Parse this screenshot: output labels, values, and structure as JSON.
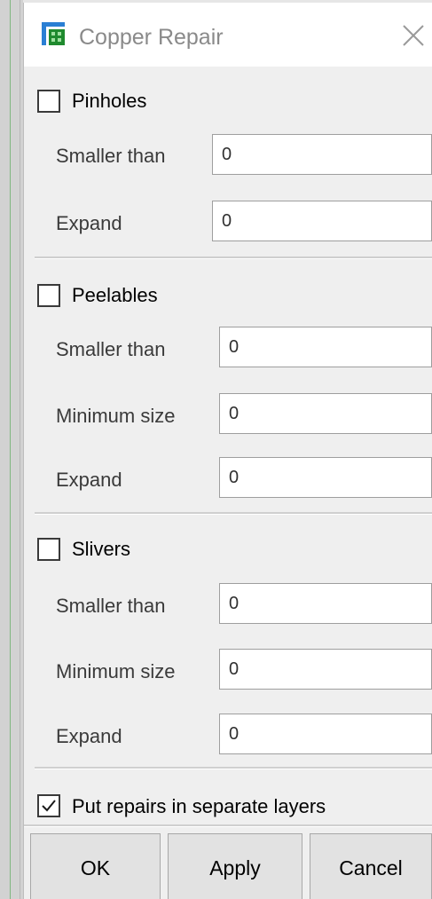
{
  "window": {
    "title": "Copper Repair",
    "icon": "pcb-app-icon",
    "close_icon": "close-icon"
  },
  "pinholes": {
    "label": "Pinholes",
    "checked": false,
    "smaller_than": {
      "label": "Smaller than",
      "value": "0"
    },
    "expand": {
      "label": "Expand",
      "value": "0"
    }
  },
  "peelables": {
    "label": "Peelables",
    "checked": false,
    "smaller_than": {
      "label": "Smaller than",
      "value": "0"
    },
    "minimum_size": {
      "label": "Minimum size",
      "value": "0"
    },
    "expand": {
      "label": "Expand",
      "value": "0"
    }
  },
  "slivers": {
    "label": "Slivers",
    "checked": false,
    "smaller_than": {
      "label": "Smaller than",
      "value": "0"
    },
    "minimum_size": {
      "label": "Minimum size",
      "value": "0"
    },
    "expand": {
      "label": "Expand",
      "value": "0"
    }
  },
  "separate_layers": {
    "label": "Put repairs in separate layers",
    "checked": true
  },
  "buttons": {
    "ok": "OK",
    "apply": "Apply",
    "cancel": "Cancel"
  }
}
